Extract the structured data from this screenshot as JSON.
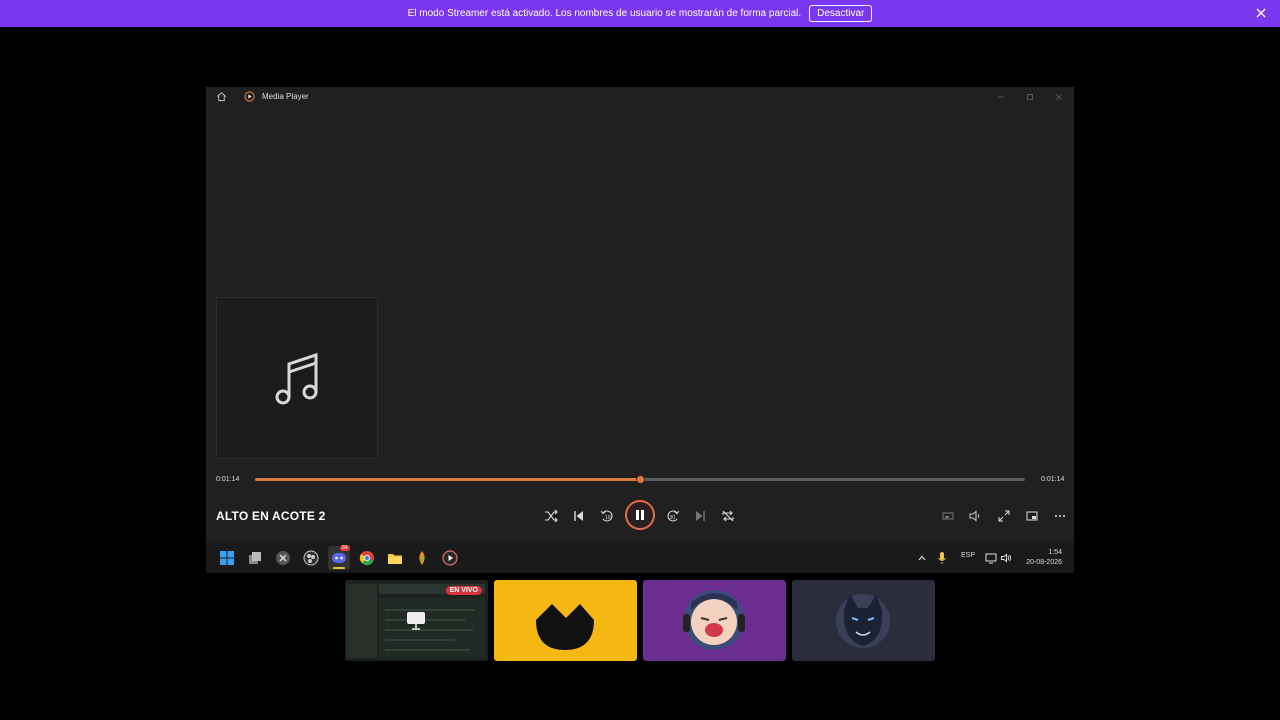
{
  "banner": {
    "message": "El modo Streamer está activado. Los nombres de usuario se mostrarán de forma parcial.",
    "button_label": "Desactivar",
    "color": "#7b37f0"
  },
  "player": {
    "app_title": "Media Player",
    "elapsed": "0:01:14",
    "duration": "0:01:14",
    "progress": 0.5,
    "song_title": "ALTO EN ACOTE 2",
    "accent": "#e0793d",
    "controls": [
      "shuffle-icon",
      "previous-icon",
      "rewind-10-icon",
      "pause-icon",
      "forward-30-icon",
      "next-icon",
      "repeat-icon"
    ],
    "right_controls": [
      "miniplayer-icon",
      "volume-icon",
      "fullscreen-icon",
      "cast-icon",
      "more-icon"
    ]
  },
  "taskbar": {
    "language": "ESP",
    "time": "1:54",
    "date": "20-08-2026",
    "discord_badge": "84",
    "icons": [
      "windows-icon",
      "task-view-icon",
      "close-app-icon",
      "obs-icon",
      "discord-icon",
      "chrome-icon",
      "file-explorer-icon",
      "fl-studio-icon",
      "media-player-icon"
    ]
  },
  "thumbnails": {
    "live_label": "EN VIVO",
    "colors": [
      "#1d2420",
      "#f5b812",
      "#6b2d8f",
      "#2b2d3c"
    ]
  }
}
